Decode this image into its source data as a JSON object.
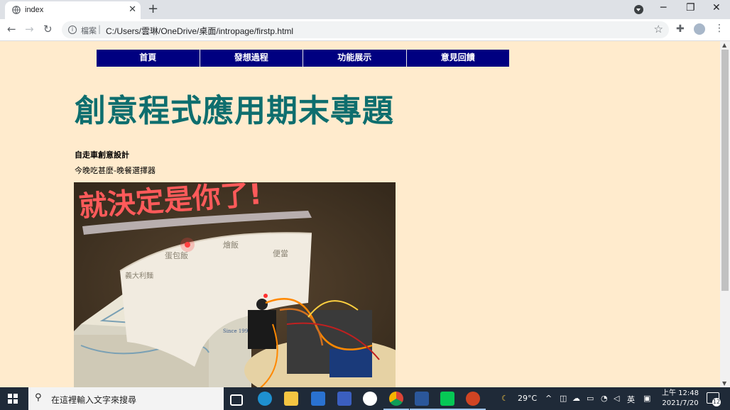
{
  "browser": {
    "tab_title": "index",
    "tab_close": "✕",
    "new_tab": "+",
    "window_controls": {
      "minimize": "─",
      "restore": "❐",
      "close": "✕"
    },
    "url_scheme": "檔案",
    "url_separator": "|",
    "url": "C:/Users/雲琳/OneDrive/桌面/intropage/firstp.html",
    "icons": [
      "globe-icon",
      "search-tabs-icon",
      "back-icon",
      "forward-icon",
      "reload-icon",
      "info-icon",
      "star-icon",
      "extensions-icon",
      "profile-icon",
      "menu-icon"
    ]
  },
  "page": {
    "nav": [
      {
        "label": "首頁"
      },
      {
        "label": "發想過程"
      },
      {
        "label": "功能展示"
      },
      {
        "label": "意見回饋"
      }
    ],
    "title": "創意程式應用期末專題",
    "subtitle": "自走車創意設計",
    "description": "今晚吃甚麼-晚餐選擇器",
    "photo_overlay_text": "就決定是你了!",
    "photo_paper_text": [
      "義大利麵",
      "蛋包飯",
      "燴飯",
      "便當"
    ],
    "photo_tin_text": "Since 1996"
  },
  "taskbar": {
    "search_placeholder": "在這裡輸入文字來搜尋",
    "weather": "29°C",
    "ime": "英",
    "time": "上午 12:48",
    "date": "2021/7/20",
    "notification_count": "12",
    "colors": {
      "bar": "#1f2a38",
      "active": "#9fc3ea"
    }
  },
  "colors": {
    "page_bg": "#ffebcd",
    "nav_bg": "#000080",
    "title": "#0e6e6e"
  }
}
